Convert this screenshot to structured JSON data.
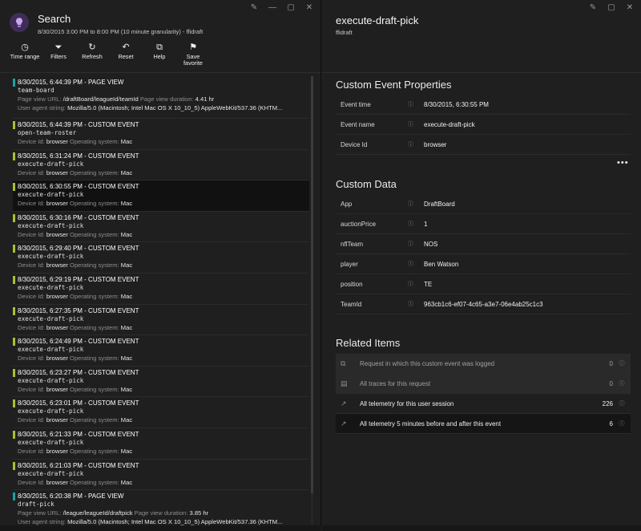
{
  "window_controls": {
    "pin": "✎",
    "minimize": "—",
    "maximize": "▢",
    "close": "✕"
  },
  "left": {
    "title": "Search",
    "subtitle": "8/30/2015 3:00 PM to 8:00 PM (10 minute granularity) - ffidraft",
    "toolbar": [
      {
        "name": "time-range",
        "icon": "clock-icon",
        "glyph": "◷",
        "label": "Time range"
      },
      {
        "name": "filters",
        "icon": "filter-icon",
        "glyph": "⏷",
        "label": "Filters"
      },
      {
        "name": "refresh",
        "icon": "refresh-icon",
        "glyph": "↻",
        "label": "Refresh"
      },
      {
        "name": "reset",
        "icon": "undo-icon",
        "glyph": "↶",
        "label": "Reset"
      },
      {
        "name": "help",
        "icon": "external-link-icon",
        "glyph": "⧉",
        "label": "Help"
      },
      {
        "name": "save-favorite",
        "icon": "bookmark-icon",
        "glyph": "⚑",
        "label": "Save favorite"
      }
    ],
    "results": [
      {
        "kind": "page",
        "time": "8/30/2015, 6:44:39 PM - PAGE VIEW",
        "name": "team-board",
        "url_label": "Page view URL:",
        "url": "/draftBoard/leagueId/teamId",
        "dur_label": "Page view duration:",
        "dur": "4.41 hr",
        "ua_label": "User agent string:",
        "ua": "Mozilla/5.0 (Macintosh; Intel Mac OS X 10_10_5) AppleWebKit/537.36 (KHTM..."
      },
      {
        "kind": "event",
        "time": "8/30/2015, 6:44:39 PM - CUSTOM EVENT",
        "name": "open-team-roster",
        "dev_label": "Device Id:",
        "dev": "browser",
        "os_label": "Operating system:",
        "os": "Mac"
      },
      {
        "kind": "event",
        "time": "8/30/2015, 6:31:24 PM - CUSTOM EVENT",
        "name": "execute-draft-pick",
        "dev_label": "Device Id:",
        "dev": "browser",
        "os_label": "Operating system:",
        "os": "Mac"
      },
      {
        "kind": "event",
        "selected": true,
        "time": "8/30/2015, 6:30:55 PM - CUSTOM EVENT",
        "name": "execute-draft-pick",
        "dev_label": "Device Id:",
        "dev": "browser",
        "os_label": "Operating system:",
        "os": "Mac"
      },
      {
        "kind": "event",
        "time": "8/30/2015, 6:30:16 PM - CUSTOM EVENT",
        "name": "execute-draft-pick",
        "dev_label": "Device Id:",
        "dev": "browser",
        "os_label": "Operating system:",
        "os": "Mac"
      },
      {
        "kind": "event",
        "time": "8/30/2015, 6:29:40 PM - CUSTOM EVENT",
        "name": "execute-draft-pick",
        "dev_label": "Device Id:",
        "dev": "browser",
        "os_label": "Operating system:",
        "os": "Mac"
      },
      {
        "kind": "event",
        "time": "8/30/2015, 6:29:19 PM - CUSTOM EVENT",
        "name": "execute-draft-pick",
        "dev_label": "Device Id:",
        "dev": "browser",
        "os_label": "Operating system:",
        "os": "Mac"
      },
      {
        "kind": "event",
        "time": "8/30/2015, 6:27:35 PM - CUSTOM EVENT",
        "name": "execute-draft-pick",
        "dev_label": "Device Id:",
        "dev": "browser",
        "os_label": "Operating system:",
        "os": "Mac"
      },
      {
        "kind": "event",
        "time": "8/30/2015, 6:24:49 PM - CUSTOM EVENT",
        "name": "execute-draft-pick",
        "dev_label": "Device Id:",
        "dev": "browser",
        "os_label": "Operating system:",
        "os": "Mac"
      },
      {
        "kind": "event",
        "time": "8/30/2015, 6:23:27 PM - CUSTOM EVENT",
        "name": "execute-draft-pick",
        "dev_label": "Device Id:",
        "dev": "browser",
        "os_label": "Operating system:",
        "os": "Mac"
      },
      {
        "kind": "event",
        "time": "8/30/2015, 6:23:01 PM - CUSTOM EVENT",
        "name": "execute-draft-pick",
        "dev_label": "Device Id:",
        "dev": "browser",
        "os_label": "Operating system:",
        "os": "Mac"
      },
      {
        "kind": "event",
        "time": "8/30/2015, 6:21:33 PM - CUSTOM EVENT",
        "name": "execute-draft-pick",
        "dev_label": "Device Id:",
        "dev": "browser",
        "os_label": "Operating system:",
        "os": "Mac"
      },
      {
        "kind": "event",
        "time": "8/30/2015, 6:21:03 PM - CUSTOM EVENT",
        "name": "execute-draft-pick",
        "dev_label": "Device Id:",
        "dev": "browser",
        "os_label": "Operating system:",
        "os": "Mac"
      },
      {
        "kind": "page",
        "time": "8/30/2015, 6:20:38 PM - PAGE VIEW",
        "name": "draft-pick",
        "url_label": "Page view URL:",
        "url": "/league/leagueId/draftpick",
        "dur_label": "Page view duration:",
        "dur": "3.85 hr",
        "ua_label": "User agent string:",
        "ua": "Mozilla/5.0 (Macintosh; Intel Mac OS X 10_10_5) AppleWebKit/537.36 (KHTM..."
      }
    ]
  },
  "right": {
    "title": "execute-draft-pick",
    "subtitle": "ffidraft",
    "props_title": "Custom Event Properties",
    "props": [
      {
        "k": "Event time",
        "v": "8/30/2015, 6:30:55 PM"
      },
      {
        "k": "Event name",
        "v": "execute-draft-pick"
      },
      {
        "k": "Device Id",
        "v": "browser"
      }
    ],
    "more": "•••",
    "custom_title": "Custom Data",
    "custom": [
      {
        "k": "App",
        "v": "DraftBoard"
      },
      {
        "k": "auctionPrice",
        "v": "1"
      },
      {
        "k": "nflTeam",
        "v": "NOS"
      },
      {
        "k": "player",
        "v": "Ben Watson"
      },
      {
        "k": "position",
        "v": "TE"
      },
      {
        "k": "TeamId",
        "v": "963cb1c6-ef07-4c65-a3e7-06e4ab25c1c3"
      }
    ],
    "related_title": "Related Items",
    "related": [
      {
        "icon": "request-icon",
        "glyph": "⧉",
        "text": "Request in which this custom event was logged",
        "count": "0",
        "state": "dim"
      },
      {
        "icon": "trace-icon",
        "glyph": "▤",
        "text": "All traces for this request",
        "count": "0",
        "state": "dim"
      },
      {
        "icon": "arrow-icon",
        "glyph": "↗",
        "text": "All telemetry for this user session",
        "count": "226",
        "state": "on"
      },
      {
        "icon": "arrow-icon",
        "glyph": "↗",
        "text": "All telemetry 5 minutes before and after this event",
        "count": "6",
        "state": "hover"
      }
    ],
    "info_glyph": "ⓘ"
  }
}
